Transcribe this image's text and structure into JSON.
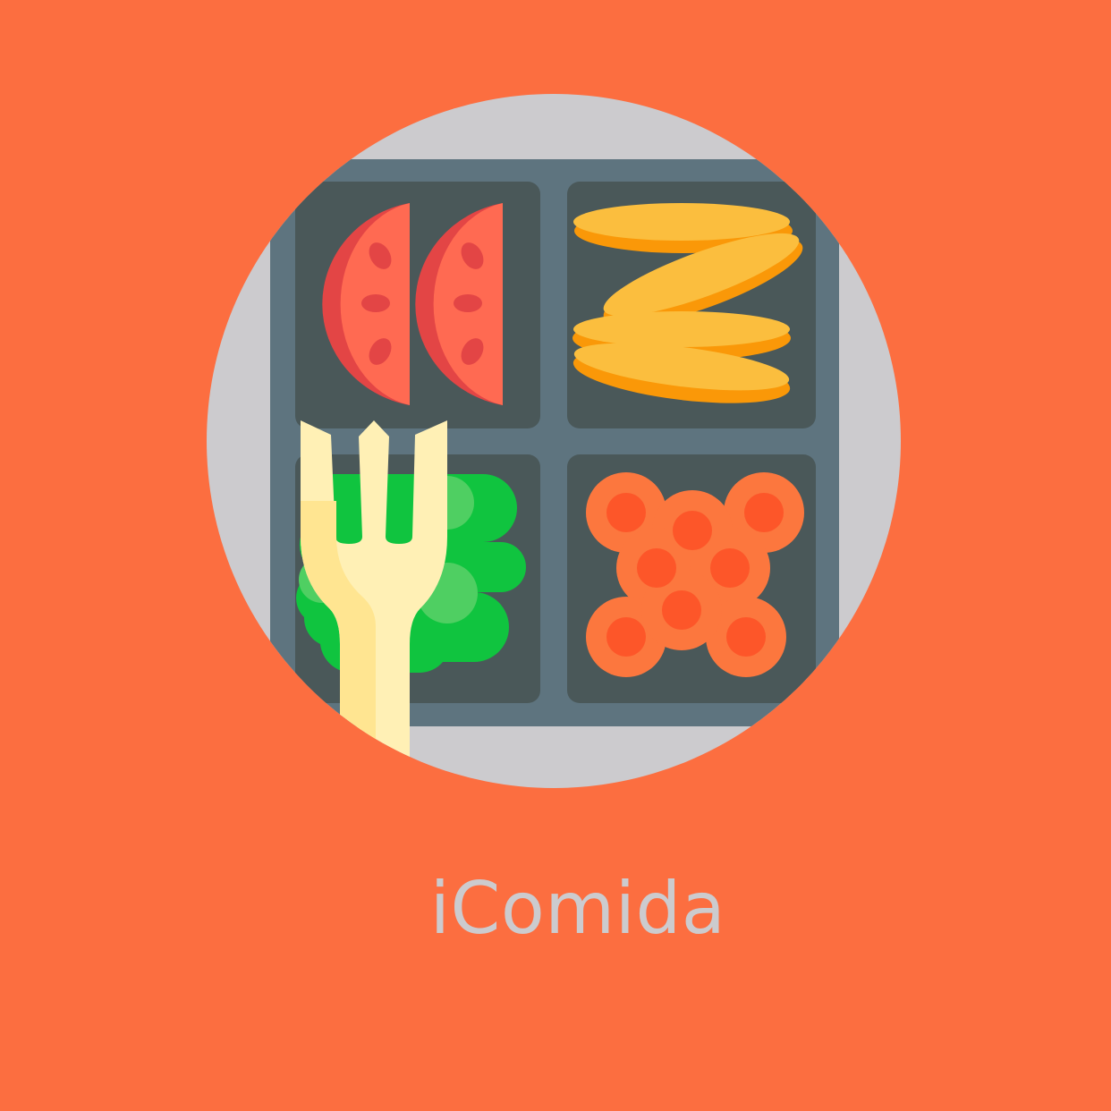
{
  "app": {
    "name": "iComida"
  },
  "logo": {
    "icon": "lunch-tray-icon",
    "parts": [
      "tomato-slices-icon",
      "cheese-slices-icon",
      "lettuce-icon",
      "carrot-slices-icon",
      "fork-icon"
    ]
  },
  "colors": {
    "background": "#FC6E40",
    "circle": "#CCCBCE",
    "tray_rim": "#5E747F",
    "tray_compartment": "#4A5859",
    "tomato_flesh": "#FF6A52",
    "tomato_skin": "#E34545",
    "cheese_light": "#FBBE3E",
    "cheese_dark": "#FA9808",
    "lettuce_dark": "#10C43F",
    "lettuce_light": "#4FCF62",
    "carrot_ring": "#FC773E",
    "carrot_core": "#FD5629",
    "fork": "#FFF0B5",
    "fork_shade": "#FFE591",
    "text": "#CCCBCE"
  }
}
